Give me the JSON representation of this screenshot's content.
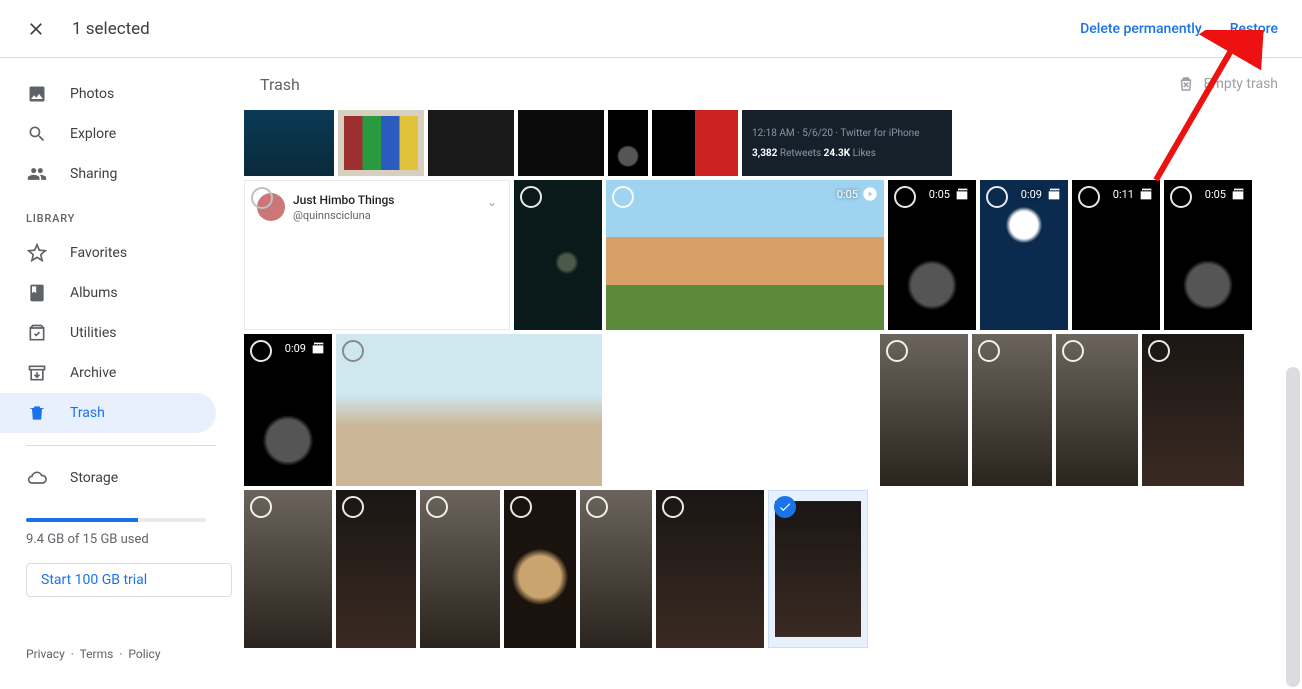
{
  "topbar": {
    "selected_label": "1 selected",
    "delete_label": "Delete permanently",
    "restore_label": "Restore"
  },
  "sidebar": {
    "items": [
      {
        "label": "Photos"
      },
      {
        "label": "Explore"
      },
      {
        "label": "Sharing"
      }
    ],
    "library_label": "LIBRARY",
    "library_items": [
      {
        "label": "Favorites"
      },
      {
        "label": "Albums"
      },
      {
        "label": "Utilities"
      },
      {
        "label": "Archive"
      },
      {
        "label": "Trash"
      }
    ],
    "storage_label": "Storage",
    "storage_text": "9.4 GB of 15 GB used",
    "trial_label": "Start 100 GB trial"
  },
  "main": {
    "title": "Trash",
    "empty_label": "Empty trash"
  },
  "footer": {
    "privacy": "Privacy",
    "terms": "Terms",
    "policy": "Policy"
  },
  "tweet": {
    "meta": "12:18 AM · 5/6/20 · Twitter for iPhone",
    "retweets_n": "3,382",
    "retweets_l": " Retweets  ",
    "likes_n": "24.3K",
    "likes_l": " Likes"
  },
  "card": {
    "name": "Just Himbo Things",
    "handle": "@quinnscicluna"
  },
  "durations": {
    "d005": "0:05",
    "d009": "0:09",
    "d011": "0:11"
  }
}
